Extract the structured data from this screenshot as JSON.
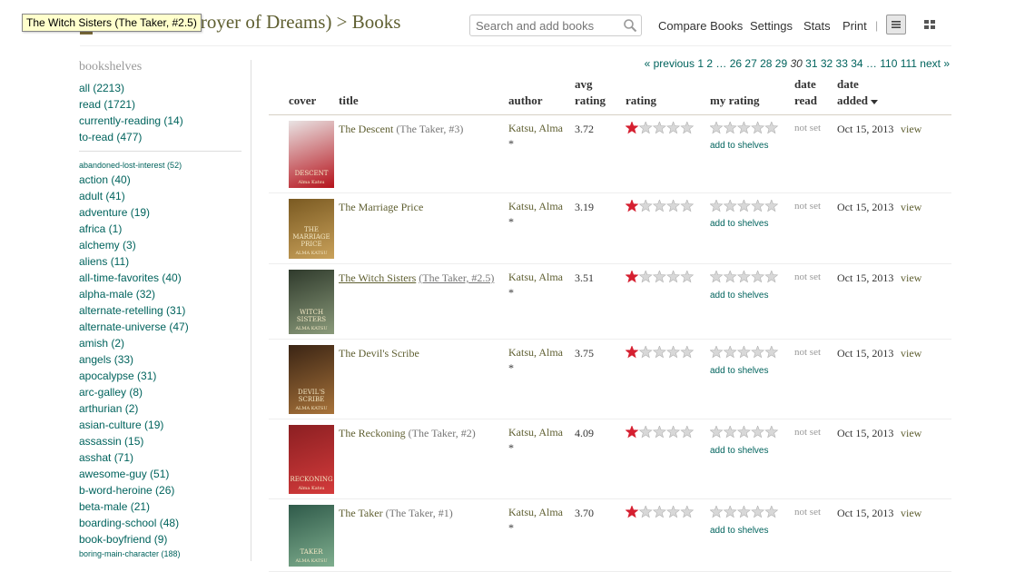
{
  "header": {
    "title": "troyer of Dreams) > Books",
    "tooltip": "The Witch Sisters (The Taker, #2.5)",
    "search_placeholder": "Search and add books",
    "nav": [
      "Compare Books",
      "Settings",
      "Stats",
      "Print"
    ],
    "separator": "|"
  },
  "sidebar": {
    "heading": "bookshelves",
    "main_shelves": [
      "all (2213)",
      "read (1721)",
      "currently-reading (14)",
      "to-read (477)"
    ],
    "first_small": "abandoned-lost-interest (52)",
    "shelves": [
      "action (40)",
      "adult (41)",
      "adventure (19)",
      "africa (1)",
      "alchemy (3)",
      "aliens (11)",
      "all-time-favorites (40)",
      "alpha-male (32)",
      "alternate-retelling (31)",
      "alternate-universe (47)",
      "amish (2)",
      "angels (33)",
      "apocalypse (31)",
      "arc-galley (8)",
      "arthurian (2)",
      "asian-culture (19)",
      "assassin (15)",
      "asshat (71)",
      "awesome-guy (51)",
      "b-word-heroine (26)",
      "beta-male (21)",
      "boarding-school (48)",
      "book-boyfriend (9)"
    ],
    "last_small": "boring-main-character (188)"
  },
  "pagination": {
    "prev": "« previous",
    "pages": [
      "1",
      "2",
      "…",
      "26",
      "27",
      "28",
      "29",
      "30",
      "31",
      "32",
      "33",
      "34",
      "…",
      "110",
      "111"
    ],
    "current": "30",
    "next": "next »"
  },
  "table": {
    "headers": {
      "cover": "cover",
      "title": "title",
      "author": "author",
      "avg_line1": "avg",
      "avg_line2": "rating",
      "rating": "rating",
      "my_rating": "my rating",
      "date_read_line1": "date",
      "date_read_line2": "read",
      "date_added_line1": "date",
      "date_added_line2": "added"
    },
    "rows": [
      {
        "title": "The Descent",
        "series": "(The Taker, #3)",
        "author": "Katsu, Alma",
        "author_mark": "*",
        "avg": "3.72",
        "rating_stars": 1,
        "add": "add to shelves",
        "date_read": "not set",
        "date_added": "Oct 15, 2013",
        "view": "view",
        "cover_text": "DESCENT",
        "cover_author": "Alma Katsu"
      },
      {
        "title": "The Marriage Price",
        "series": "",
        "author": "Katsu, Alma",
        "author_mark": "*",
        "avg": "3.19",
        "rating_stars": 1,
        "add": "add to shelves",
        "date_read": "not set",
        "date_added": "Oct 15, 2013",
        "view": "view",
        "cover_text": "THE MARRIAGE PRICE",
        "cover_author": "ALMA KATSU"
      },
      {
        "title": "The Witch Sisters",
        "series": "(The Taker, #2.5)",
        "author": "Katsu, Alma",
        "author_mark": "*",
        "avg": "3.51",
        "rating_stars": 1,
        "add": "add to shelves",
        "date_read": "not set",
        "date_added": "Oct 15, 2013",
        "view": "view",
        "cover_text": "WITCH SISTERS",
        "cover_author": "ALMA KATSU"
      },
      {
        "title": "The Devil's Scribe",
        "series": "",
        "author": "Katsu, Alma",
        "author_mark": "*",
        "avg": "3.75",
        "rating_stars": 1,
        "add": "add to shelves",
        "date_read": "not set",
        "date_added": "Oct 15, 2013",
        "view": "view",
        "cover_text": "DEVIL'S SCRIBE",
        "cover_author": "ALMA KATSU"
      },
      {
        "title": "The Reckoning",
        "series": "(The Taker, #2)",
        "author": "Katsu, Alma",
        "author_mark": "*",
        "avg": "4.09",
        "rating_stars": 1,
        "add": "add to shelves",
        "date_read": "not set",
        "date_added": "Oct 15, 2013",
        "view": "view",
        "cover_text": "RECKONING",
        "cover_author": "Alma Katsu"
      },
      {
        "title": "The Taker",
        "series": "(The Taker, #1)",
        "author": "Katsu, Alma",
        "author_mark": "*",
        "avg": "3.70",
        "rating_stars": 1,
        "add": "add to shelves",
        "date_read": "not set",
        "date_added": "Oct 15, 2013",
        "view": "view",
        "cover_text": "TAKER",
        "cover_author": "ALMA KATSU"
      }
    ]
  },
  "colors": {
    "link": "#00635d",
    "title": "#5f5f31",
    "star_filled": "#d51f30",
    "star_empty": "#cccccc"
  },
  "icons": [
    "search-icon",
    "list-view-icon",
    "grid-view-icon",
    "sort-desc-icon",
    "star-icon"
  ]
}
